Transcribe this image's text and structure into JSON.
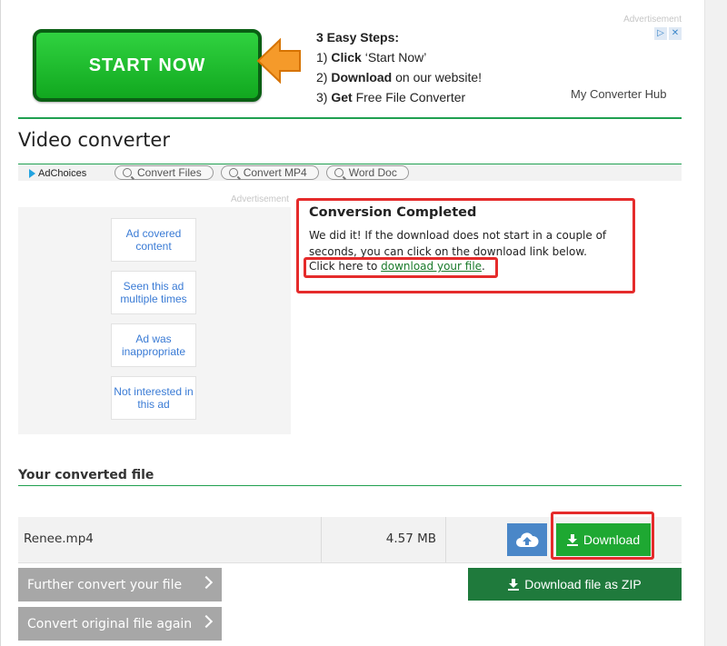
{
  "top_ad": {
    "label": "Advertisement",
    "start_button": "START NOW",
    "steps_title": "3 Easy Steps:",
    "step1_prefix": "1) ",
    "step1_bold": "Click",
    "step1_rest": " ‘Start Now’",
    "step2_prefix": "2) ",
    "step2_bold": "Download",
    "step2_rest": " on our website!",
    "step3_prefix": "3) ",
    "step3_bold": "Get",
    "step3_rest": " Free File Converter",
    "advertiser": "My Converter Hub",
    "ad_icon_1": "▷",
    "ad_icon_2": "✕"
  },
  "page_title": "Video converter",
  "ad_bar": {
    "adchoices": "AdChoices",
    "chips": [
      "Convert Files",
      "Convert MP4",
      "Word Doc"
    ]
  },
  "left_ad": {
    "label": "Advertisement",
    "feedback": [
      "Ad covered content",
      "Seen this ad multiple times",
      "Ad was inappropriate",
      "Not interested in this ad"
    ]
  },
  "conversion": {
    "title": "Conversion Completed",
    "message": "We did it! If the download does not start in a couple of seconds, you can click on the download link below.",
    "link_prefix": "Click here to ",
    "link_text": "download your file",
    "link_suffix": "."
  },
  "converted": {
    "section_title": "Your converted file",
    "file_name": "Renee.mp4",
    "file_size": "4.57 MB",
    "download_label": "Download"
  },
  "actions": {
    "further_convert": "Further convert your file",
    "convert_again": "Convert original file again",
    "zip": "Download file as ZIP"
  },
  "colors": {
    "accent_green": "#1ea832",
    "highlight_red": "#e52b2b",
    "zip_green": "#1f7a3c"
  }
}
